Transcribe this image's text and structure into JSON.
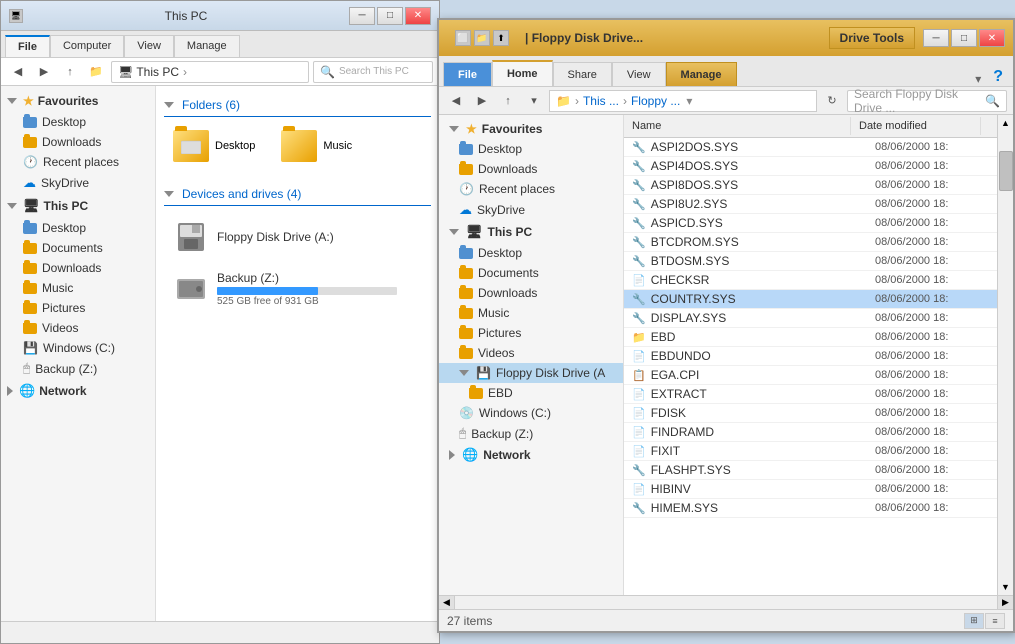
{
  "thispc": {
    "title": "This PC",
    "tabs": [
      "File",
      "Computer",
      "View",
      "Manage"
    ],
    "active_tab": "Computer",
    "address": "This PC",
    "search_placeholder": "Search This PC",
    "folders_section": "Folders (6)",
    "folders": [
      {
        "name": "Desktop",
        "type": "folder"
      },
      {
        "name": "Music",
        "type": "folder"
      }
    ],
    "devices_section": "Devices and drives (4)",
    "devices": [
      {
        "name": "Floppy Disk Drive (A:)",
        "type": "floppy"
      },
      {
        "name": "Backup (Z:)",
        "type": "hdd",
        "bar_width": "56%",
        "free": "525 GB free of 931 GB"
      }
    ],
    "sidebar": {
      "favourites_label": "Favourites",
      "items": [
        {
          "label": "Desktop",
          "indent": 1
        },
        {
          "label": "Downloads",
          "indent": 1
        },
        {
          "label": "Recent places",
          "indent": 1
        },
        {
          "label": "SkyDrive",
          "indent": 1
        }
      ],
      "thispc_label": "This PC",
      "thispc_items": [
        {
          "label": "Desktop",
          "indent": 2
        },
        {
          "label": "Documents",
          "indent": 2
        },
        {
          "label": "Downloads",
          "indent": 2
        },
        {
          "label": "Music",
          "indent": 2
        },
        {
          "label": "Pictures",
          "indent": 2
        },
        {
          "label": "Videos",
          "indent": 2
        },
        {
          "label": "Windows (C:)",
          "indent": 2
        },
        {
          "label": "Backup (Z:)",
          "indent": 2
        }
      ],
      "network_label": "Network"
    },
    "status": ""
  },
  "floppy": {
    "title": "| Floppy Disk Drive...",
    "drive_tools_label": "Drive Tools",
    "tabs": [
      "File",
      "Home",
      "Share",
      "View",
      "Manage"
    ],
    "active_tab": "Home",
    "highlighted_tab": "Manage",
    "address_parts": [
      "This ...",
      "Floppy ..."
    ],
    "search_placeholder": "Search Floppy Disk Drive ...",
    "sidebar": {
      "favourites_label": "Favourites",
      "items": [
        {
          "label": "Desktop",
          "indent": 1
        },
        {
          "label": "Downloads",
          "indent": 1
        },
        {
          "label": "Recent places",
          "indent": 1
        },
        {
          "label": "SkyDrive",
          "indent": 1
        }
      ],
      "thispc_label": "This PC",
      "thispc_items": [
        {
          "label": "Desktop",
          "indent": 2
        },
        {
          "label": "Documents",
          "indent": 2
        },
        {
          "label": "Downloads",
          "indent": 2
        },
        {
          "label": "Music",
          "indent": 2
        },
        {
          "label": "Pictures",
          "indent": 2
        },
        {
          "label": "Videos",
          "indent": 2
        },
        {
          "label": "Floppy Disk Drive (A",
          "indent": 2
        },
        {
          "label": "EBD",
          "indent": 3
        },
        {
          "label": "Windows (C:)",
          "indent": 2
        },
        {
          "label": "Backup (Z:)",
          "indent": 2
        }
      ],
      "network_label": "Network"
    },
    "files": [
      {
        "name": "ASPI2DOS.SYS",
        "date": "08/06/2000 18:",
        "type": "sys"
      },
      {
        "name": "ASPI4DOS.SYS",
        "date": "08/06/2000 18:",
        "type": "sys"
      },
      {
        "name": "ASPI8DOS.SYS",
        "date": "08/06/2000 18:",
        "type": "sys"
      },
      {
        "name": "ASPI8U2.SYS",
        "date": "08/06/2000 18:",
        "type": "sys"
      },
      {
        "name": "ASPICD.SYS",
        "date": "08/06/2000 18:",
        "type": "sys"
      },
      {
        "name": "BTCDROM.SYS",
        "date": "08/06/2000 18:",
        "type": "sys"
      },
      {
        "name": "BTDOSM.SYS",
        "date": "08/06/2000 18:",
        "type": "sys"
      },
      {
        "name": "CHECKSR",
        "date": "08/06/2000 18:",
        "type": "doc"
      },
      {
        "name": "COUNTRY.SYS",
        "date": "08/06/2000 18:",
        "type": "sys"
      },
      {
        "name": "DISPLAY.SYS",
        "date": "08/06/2000 18:",
        "type": "sys"
      },
      {
        "name": "EBD",
        "date": "08/06/2000 18:",
        "type": "folder"
      },
      {
        "name": "EBDUNDO",
        "date": "08/06/2000 18:",
        "type": "doc"
      },
      {
        "name": "EGA.CPI",
        "date": "08/06/2000 18:",
        "type": "txt"
      },
      {
        "name": "EXTRACT",
        "date": "08/06/2000 18:",
        "type": "doc"
      },
      {
        "name": "FDISK",
        "date": "08/06/2000 18:",
        "type": "doc"
      },
      {
        "name": "FINDRAMD",
        "date": "08/06/2000 18:",
        "type": "doc"
      },
      {
        "name": "FIXIT",
        "date": "08/06/2000 18:",
        "type": "doc"
      },
      {
        "name": "FLASHPT.SYS",
        "date": "08/06/2000 18:",
        "type": "sys"
      },
      {
        "name": "HIBINV",
        "date": "08/06/2000 18:",
        "type": "doc"
      },
      {
        "name": "HIMEM.SYS",
        "date": "08/06/2000 18:",
        "type": "sys"
      }
    ],
    "col_name": "Name",
    "col_date": "Date modified",
    "status": "27 items",
    "view_icons": [
      "⊞",
      "≡"
    ]
  }
}
